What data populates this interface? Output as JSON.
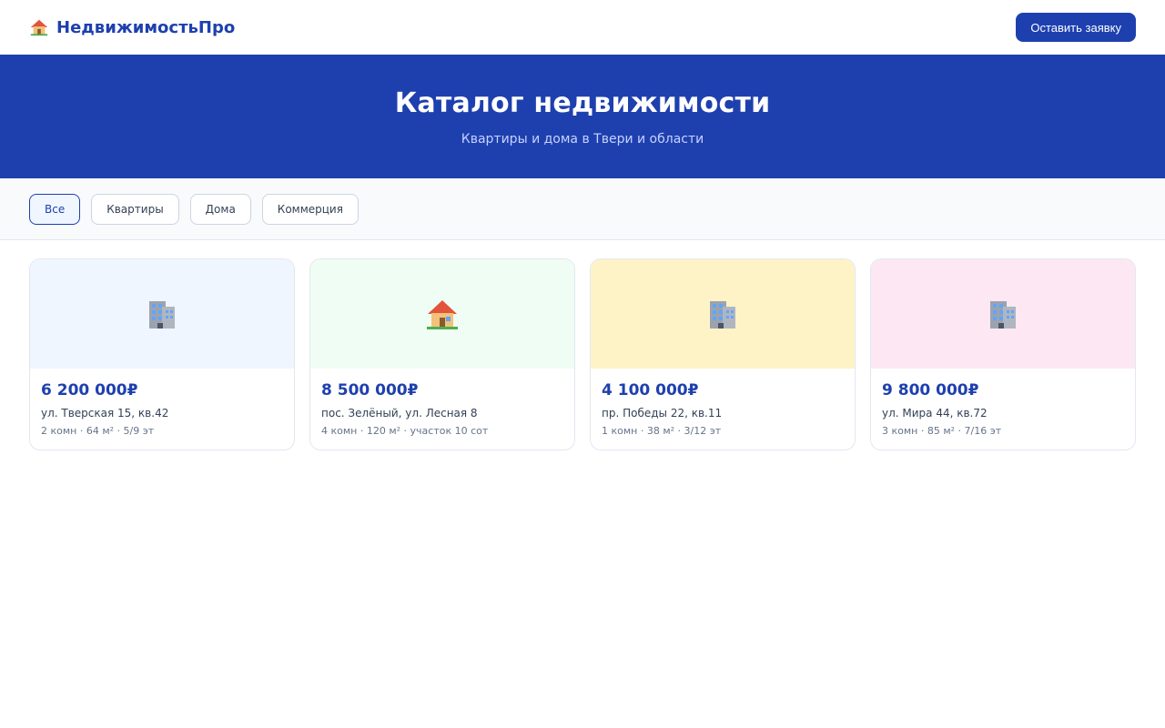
{
  "header": {
    "brand_icon": "house-icon",
    "brand_name": "НедвижимостьПро",
    "cta_label": "Оставить заявку"
  },
  "hero": {
    "title": "Каталог недвижимости",
    "subtitle": "Квартиры и дома в Твери и области"
  },
  "filters": {
    "items": [
      "Все",
      "Квартиры",
      "Дома",
      "Коммерция"
    ],
    "active": "Все"
  },
  "listings": [
    {
      "icon": "apartment-building-icon",
      "bg": "#eff6ff",
      "price": "6 200 000₽",
      "address": "ул. Тверская 15, кв.42",
      "details": "2 комн · 64 м² · 5/9 эт"
    },
    {
      "icon": "house-icon",
      "bg": "#f0fdf4",
      "price": "8 500 000₽",
      "address": "пос. Зелёный, ул. Лесная 8",
      "details": "4 комн · 120 м² · участок 10 сот"
    },
    {
      "icon": "apartment-building-icon",
      "bg": "#fef3c7",
      "price": "4 100 000₽",
      "address": "пр. Победы 22, кв.11",
      "details": "1 комн · 38 м² · 3/12 эт"
    },
    {
      "icon": "apartment-building-icon",
      "bg": "#fce7f3",
      "price": "9 800 000₽",
      "address": "ул. Мира 44, кв.72",
      "details": "3 комн · 85 м² · 7/16 эт"
    }
  ],
  "colors": {
    "primary": "#1e40af",
    "hero_subtitle": "#c7d2fe"
  }
}
